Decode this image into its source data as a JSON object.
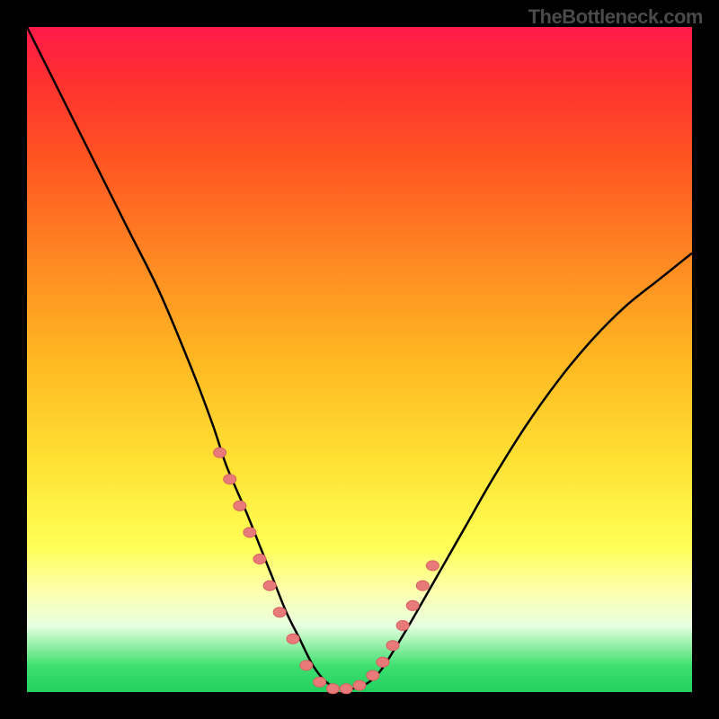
{
  "watermark": "TheBottleneck.com",
  "colors": {
    "frame": "#000000",
    "gradient_top": "#ff1a4a",
    "gradient_bottom": "#20d060",
    "marker": "#e87a7a",
    "curve": "#000000",
    "watermark_text": "#4a4a4a"
  },
  "chart_data": {
    "type": "line",
    "title": "",
    "xlabel": "",
    "ylabel": "",
    "xlim": [
      0,
      100
    ],
    "ylim": [
      0,
      100
    ],
    "series": [
      {
        "name": "bottleneck-curve",
        "x": [
          0,
          5,
          10,
          15,
          20,
          25,
          28,
          30,
          33,
          35,
          37,
          39,
          41,
          43,
          45,
          47,
          49,
          51,
          53,
          55,
          58,
          62,
          66,
          70,
          75,
          80,
          85,
          90,
          95,
          100
        ],
        "values": [
          100,
          90,
          80,
          70,
          60,
          48,
          40,
          34,
          27,
          22,
          17,
          12,
          8,
          4,
          1.5,
          0.5,
          0.5,
          1.2,
          3,
          6,
          11,
          18,
          25,
          32,
          40,
          47,
          53,
          58,
          62,
          66
        ]
      }
    ],
    "markers": {
      "name": "highlight-points",
      "x": [
        29,
        30.5,
        32,
        33.5,
        35,
        36.5,
        38,
        40,
        42,
        44,
        46,
        48,
        50,
        52,
        53.5,
        55,
        56.5,
        58,
        59.5,
        61
      ],
      "values": [
        36,
        32,
        28,
        24,
        20,
        16,
        12,
        8,
        4,
        1.5,
        0.5,
        0.5,
        1,
        2.5,
        4.5,
        7,
        10,
        13,
        16,
        19
      ]
    }
  }
}
